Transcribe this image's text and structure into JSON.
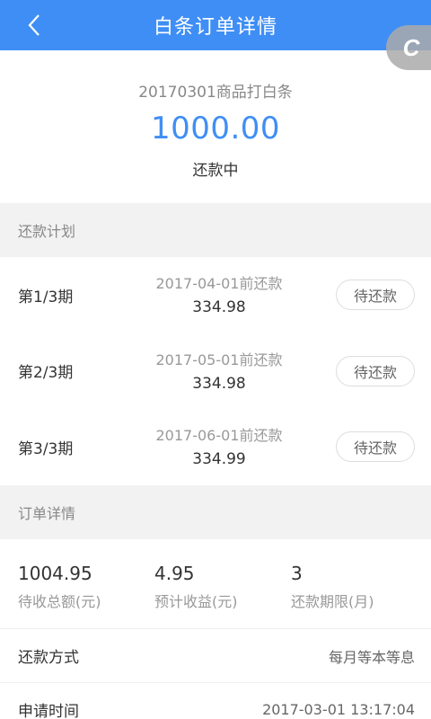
{
  "header": {
    "title": "白条订单详情"
  },
  "float_button": {
    "label": "C"
  },
  "summary": {
    "order_name": "20170301商品打白条",
    "amount": "1000.00",
    "status": "还款中"
  },
  "plan_section": {
    "label": "还款计划"
  },
  "plan": [
    {
      "period": "第1/3期",
      "due": "2017-04-01前还款",
      "amount": "334.98",
      "button": "待还款"
    },
    {
      "period": "第2/3期",
      "due": "2017-05-01前还款",
      "amount": "334.98",
      "button": "待还款"
    },
    {
      "period": "第3/3期",
      "due": "2017-06-01前还款",
      "amount": "334.99",
      "button": "待还款"
    }
  ],
  "details_section": {
    "label": "订单详情"
  },
  "stats": [
    {
      "value": "1004.95",
      "label": "待收总额(元)"
    },
    {
      "value": "4.95",
      "label": "预计收益(元)"
    },
    {
      "value": "3",
      "label": "还款期限(月)"
    }
  ],
  "rows": [
    {
      "key": "还款方式",
      "value": "每月等本等息"
    },
    {
      "key": "申请时间",
      "value": "2017-03-01 13:17:04"
    }
  ],
  "colors": {
    "accent": "#3f8ef5"
  }
}
